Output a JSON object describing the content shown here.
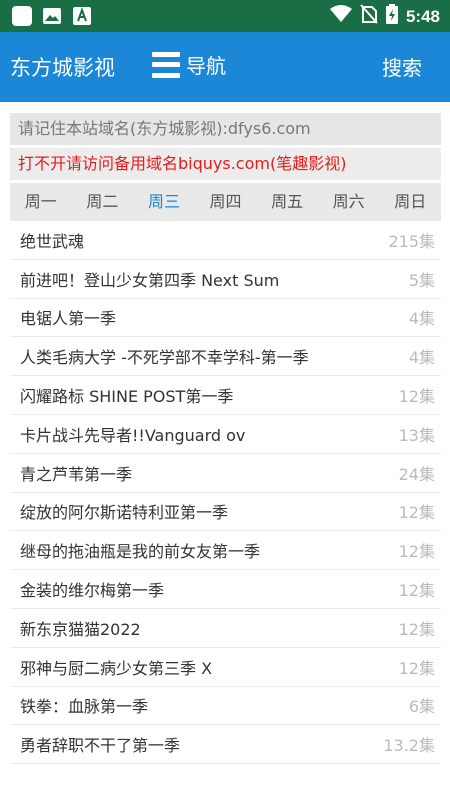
{
  "status_bar": {
    "time": "5:48",
    "icons": [
      "notification-square-icon",
      "image-icon",
      "app-a-icon",
      "wifi-icon",
      "no-sim-icon",
      "battery-icon"
    ]
  },
  "app_bar": {
    "title": "东方城影视",
    "nav_label": "导航",
    "search_label": "搜索",
    "color": "#1b87d6"
  },
  "notices": {
    "domain_notice": "请记住本站域名(东方城影视):dfys6.com",
    "backup_notice": "打不开请访问备用域名biquys.com(笔趣影视)",
    "backup_color": "#e51c1c"
  },
  "weekdays": {
    "days": [
      "周一",
      "周二",
      "周三",
      "周四",
      "周五",
      "周六",
      "周日"
    ],
    "active": "周三"
  },
  "list": [
    {
      "title": "绝世武魂",
      "count": "215集"
    },
    {
      "title": "前进吧！登山少女第四季 Next Sum",
      "count": "5集"
    },
    {
      "title": "电锯人第一季",
      "count": "4集"
    },
    {
      "title": "人类毛病大学 -不死学部不幸学科-第一季",
      "count": "4集"
    },
    {
      "title": "闪耀路标 SHINE POST第一季",
      "count": "12集"
    },
    {
      "title": "卡片战斗先导者!!Vanguard ov",
      "count": "13集"
    },
    {
      "title": "青之芦苇第一季",
      "count": "24集"
    },
    {
      "title": "绽放的阿尔斯诺特利亚第一季",
      "count": "12集"
    },
    {
      "title": "继母的拖油瓶是我的前女友第一季",
      "count": "12集"
    },
    {
      "title": "金装的维尔梅第一季",
      "count": "12集"
    },
    {
      "title": "新东京猫猫2022",
      "count": "12集"
    },
    {
      "title": "邪神与厨二病少女第三季 X",
      "count": "12集"
    },
    {
      "title": "铁拳：血脉第一季",
      "count": "6集"
    },
    {
      "title": "勇者辞职不干了第一季",
      "count": "13.2集"
    }
  ]
}
